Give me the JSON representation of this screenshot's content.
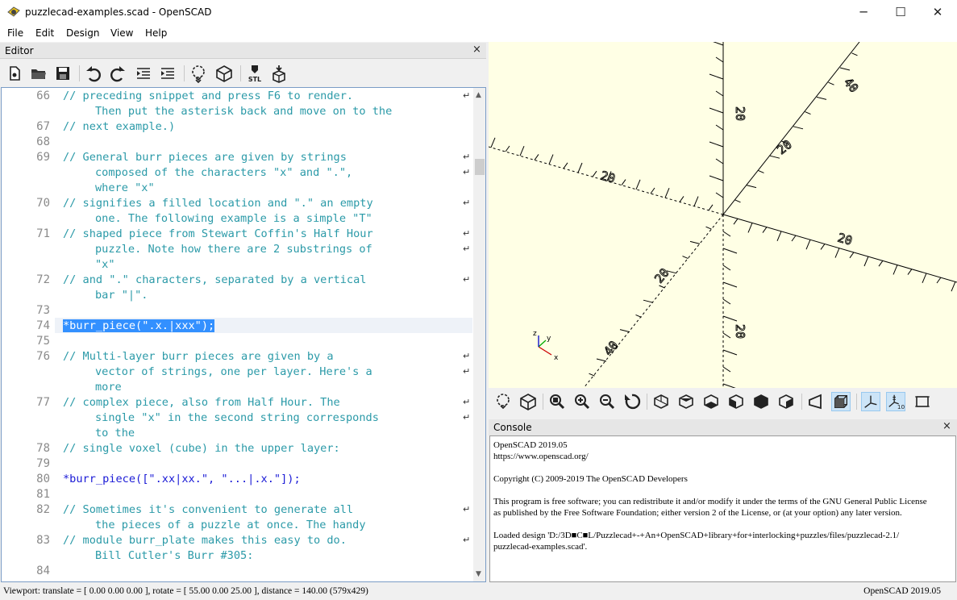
{
  "window": {
    "title": "puzzlecad-examples.scad - OpenSCAD",
    "minimize": "─",
    "maximize": "☐",
    "close": "✕"
  },
  "menu": [
    "File",
    "Edit",
    "Design",
    "View",
    "Help"
  ],
  "editor": {
    "title": "Editor",
    "close": "×",
    "toolbar": [
      "new-file-icon",
      "open-file-icon",
      "save-icon",
      "undo-icon",
      "redo-icon",
      "unindent-icon",
      "indent-icon",
      "preview-icon",
      "render-icon",
      "export-stl-icon",
      "send-to-3d-print-icon"
    ],
    "stl_label": "STL",
    "lines": [
      {
        "n": "66",
        "rows": [
          "// preceding snippet and press F6 to render.",
          "Then put the asterisk back and move on to the"
        ],
        "wrap": true
      },
      {
        "n": "67",
        "rows": [
          "// next example.)"
        ]
      },
      {
        "n": "68",
        "rows": [
          ""
        ]
      },
      {
        "n": "69",
        "rows": [
          "// General burr pieces are given by strings",
          "composed of the characters \"x\" and \".\",",
          "where \"x\""
        ],
        "wrap": true
      },
      {
        "n": "70",
        "rows": [
          "// signifies a filled location and \".\" an empty",
          "one. The following example is a simple \"T\""
        ],
        "wrap": true
      },
      {
        "n": "71",
        "rows": [
          "// shaped piece from Stewart Coffin's Half Hour",
          "puzzle. Note how there are 2 substrings of",
          "\"x\""
        ],
        "wrap": true
      },
      {
        "n": "72",
        "rows": [
          "// and \".\" characters, separated by a vertical",
          "bar \"|\"."
        ],
        "wrap": true
      },
      {
        "n": "73",
        "rows": [
          ""
        ]
      },
      {
        "n": "74",
        "rows": [
          "*burr_piece(\".x.|xxx\");"
        ],
        "selected": true
      },
      {
        "n": "75",
        "rows": [
          ""
        ]
      },
      {
        "n": "76",
        "rows": [
          "// Multi-layer burr pieces are given by a",
          "vector of strings, one per layer. Here's a",
          "more"
        ],
        "wrap": true
      },
      {
        "n": "77",
        "rows": [
          "// complex piece, also from Half Hour. The",
          "single \"x\" in the second string corresponds",
          "to the"
        ],
        "wrap": true
      },
      {
        "n": "78",
        "rows": [
          "// single voxel (cube) in the upper layer:"
        ]
      },
      {
        "n": "79",
        "rows": [
          ""
        ]
      },
      {
        "n": "80",
        "rows": [
          "*burr_piece([\".xx|xx.\", \"...|.x.\"]);"
        ],
        "code": true
      },
      {
        "n": "81",
        "rows": [
          ""
        ]
      },
      {
        "n": "82",
        "rows": [
          "// Sometimes it's convenient to generate all",
          "the pieces of a puzzle at once. The handy"
        ],
        "wrap": true
      },
      {
        "n": "83",
        "rows": [
          "// module burr_plate makes this easy to do.",
          "Bill Cutler's Burr #305:"
        ],
        "wrap": true
      },
      {
        "n": "84",
        "rows": [
          ""
        ]
      }
    ]
  },
  "viewport": {
    "background": "#ffffe5",
    "axis_labels": [
      "20",
      "40",
      "20",
      "20",
      "20",
      "20",
      "20",
      "40"
    ],
    "view_toolbar": [
      "preview-icon",
      "render-icon",
      "view-all-icon",
      "zoom-in-icon",
      "zoom-out-icon",
      "reset-view-icon",
      "view-right-icon",
      "view-top-icon",
      "view-bottom-icon",
      "view-left-icon",
      "view-front-icon",
      "view-back-icon",
      "perspective-icon",
      "orthogonal-icon",
      "show-axes-icon",
      "show-scale-markers-icon",
      "show-edges-icon"
    ]
  },
  "console": {
    "title": "Console",
    "close": "×",
    "lines": [
      "OpenSCAD 2019.05",
      "https://www.openscad.org/",
      "",
      "Copyright (C) 2009-2019 The OpenSCAD Developers",
      "",
      "This program is free software; you can redistribute it and/or modify it under the terms of the GNU General Public License",
      "as published by the Free Software Foundation; either version 2 of the License, or (at your option) any later version.",
      "",
      "Loaded design 'D:/3D■C■L/Puzzlecad+-+An+OpenSCAD+library+for+interlocking+puzzles/files/puzzlecad-2.1/",
      "puzzlecad-examples.scad'."
    ]
  },
  "status": {
    "left": "Viewport: translate = [ 0.00 0.00 0.00 ], rotate = [ 55.00 0.00 25.00 ], distance = 140.00 (579x429)",
    "right": "OpenSCAD 2019.05"
  }
}
